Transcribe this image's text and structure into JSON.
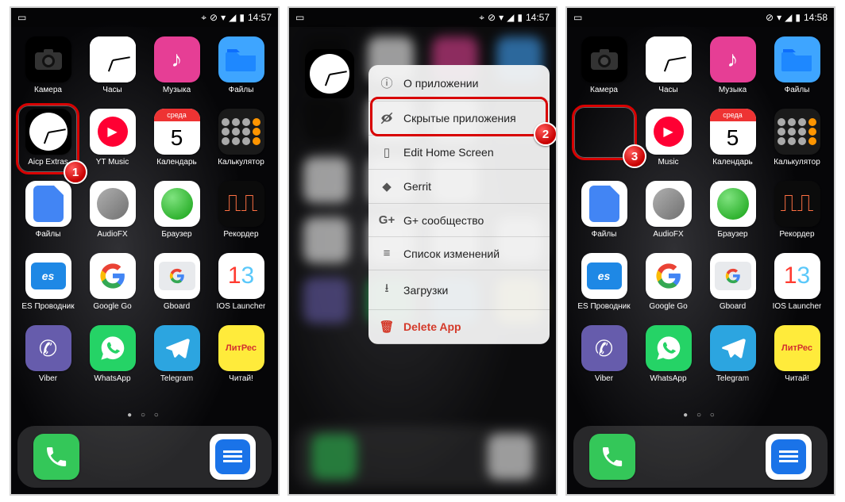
{
  "status": {
    "time1": "14:57",
    "time2": "14:57",
    "time3": "14:58"
  },
  "apps_row1": {
    "a": "Камера",
    "b": "Часы",
    "c": "Музыка",
    "d": "Файлы"
  },
  "apps_row2": {
    "a": "Aicp Extras",
    "b": "YT Music",
    "c": "Календарь",
    "d": "Калькулятор",
    "calendar_day_label": "среда",
    "calendar_day_num": "5"
  },
  "apps_row3": {
    "a": "Файлы",
    "b": "AudioFX",
    "c": "Браузер",
    "d": "Рекордер"
  },
  "apps_row4": {
    "a": "ES Проводник",
    "b": "Google Go",
    "c": "Gboard",
    "d": "IOS Launcher"
  },
  "apps_row5": {
    "a": "Viber",
    "b": "WhatsApp",
    "c": "Telegram",
    "d": "Читай!"
  },
  "badges": {
    "b1": "1",
    "b2": "2",
    "b3": "3"
  },
  "screen3_row2_b_label": "Music",
  "menu": {
    "about": "О приложении",
    "hidden": "Скрытые приложения",
    "edit_home": "Edit Home Screen",
    "gerrit": "Gerrit",
    "gplus": "G+ сообщество",
    "changelog": "Список изменений",
    "downloads": "Загрузки",
    "delete": "Delete App"
  }
}
